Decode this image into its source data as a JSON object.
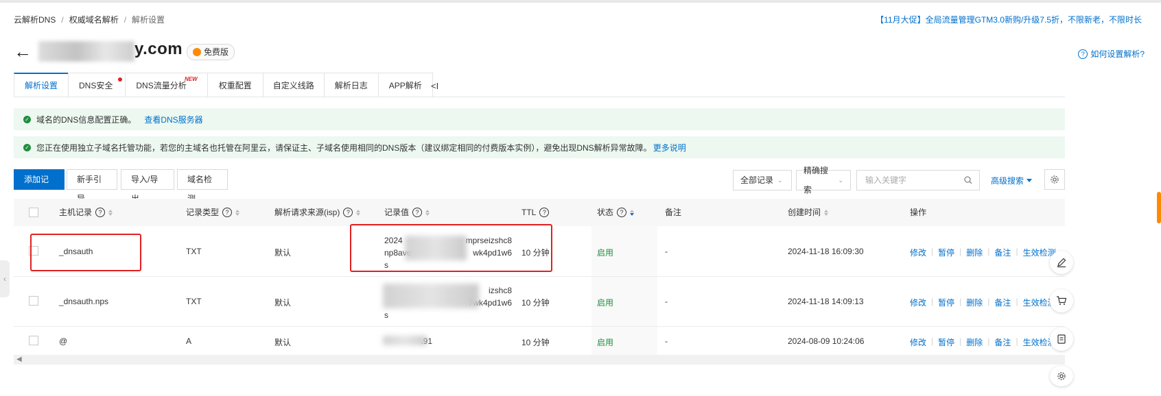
{
  "breadcrumb": [
    "云解析DNS",
    "权威域名解析",
    "解析设置"
  ],
  "promo": "【11月大促】全局流量管理GTM3.0新购/升级7.5折，不限新老，不限时长",
  "domain": {
    "name": "y.com",
    "edition": "免费版"
  },
  "help_link": "如何设置解析?",
  "tabs": [
    {
      "label": "解析设置"
    },
    {
      "label": "DNS安全"
    },
    {
      "label": "DNS流量分析",
      "badge": "NEW"
    },
    {
      "label": "权重配置"
    },
    {
      "label": "自定义线路"
    },
    {
      "label": "解析日志"
    },
    {
      "label": "APP解析"
    }
  ],
  "tabs_more": "<I",
  "alerts": [
    {
      "text": "域名的DNS信息配置正确。",
      "link": "查看DNS服务器"
    },
    {
      "text": "您正在使用独立子域名托管功能，若您的主域名也托管在阿里云，请保证主、子域名使用相同的DNS版本（建议绑定相同的付费版本实例），避免出现DNS解析异常故障。",
      "link": "更多说明"
    }
  ],
  "toolbar": {
    "add": "添加记录",
    "guide": "新手引导",
    "import_export": "导入/导出",
    "check": "域名检测",
    "filter_all": "全部记录",
    "filter_exact": "精确搜索",
    "search_placeholder": "输入关键字",
    "advanced": "高级搜索"
  },
  "columns": {
    "host": "主机记录",
    "type": "记录类型",
    "isp": "解析请求来源(isp)",
    "value": "记录值",
    "ttl": "TTL",
    "status": "状态",
    "remark": "备注",
    "created": "创建时间",
    "ops": "操作"
  },
  "rows": [
    {
      "host": "_dnsauth",
      "type": "TXT",
      "isp": "默认",
      "value_l1": "2024",
      "value_l1b": "mprseizshc8",
      "value_l2": "np8ave",
      "value_l2b": "wk4pd1w6",
      "value_l3": "s",
      "ttl": "10 分钟",
      "status": "启用",
      "remark": "-",
      "created": "2024-11-18 16:09:30"
    },
    {
      "host": "_dnsauth.nps",
      "type": "TXT",
      "isp": "默认",
      "value_l1": "",
      "value_l1b": "izshc8",
      "value_l2": "",
      "value_l2b": "7wk4pd1w6",
      "value_l3": "s",
      "ttl": "10 分钟",
      "status": "启用",
      "remark": "-",
      "created": "2024-11-18 14:09:13"
    },
    {
      "host": "@",
      "type": "A",
      "isp": "默认",
      "value_l1": "",
      "value_l1b": ".91",
      "value_l2": "",
      "value_l2b": "",
      "value_l3": "",
      "ttl": "10 分钟",
      "status": "启用",
      "remark": "-",
      "created": "2024-08-09 10:24:06"
    }
  ],
  "ops": [
    "修改",
    "暂停",
    "删除",
    "备注",
    "生效检测"
  ],
  "icons": {
    "back": "arrow-left-icon",
    "shield": "shield-icon",
    "help": "question-icon",
    "search": "search-icon",
    "gear": "gear-icon",
    "edit": "pen-icon",
    "cart": "cart-icon",
    "doc": "doc-icon"
  },
  "colors": {
    "accent": "#0070cc",
    "success": "#1e8e3e",
    "alert_bg": "#ecf8f0",
    "highlight": "#e02020"
  }
}
